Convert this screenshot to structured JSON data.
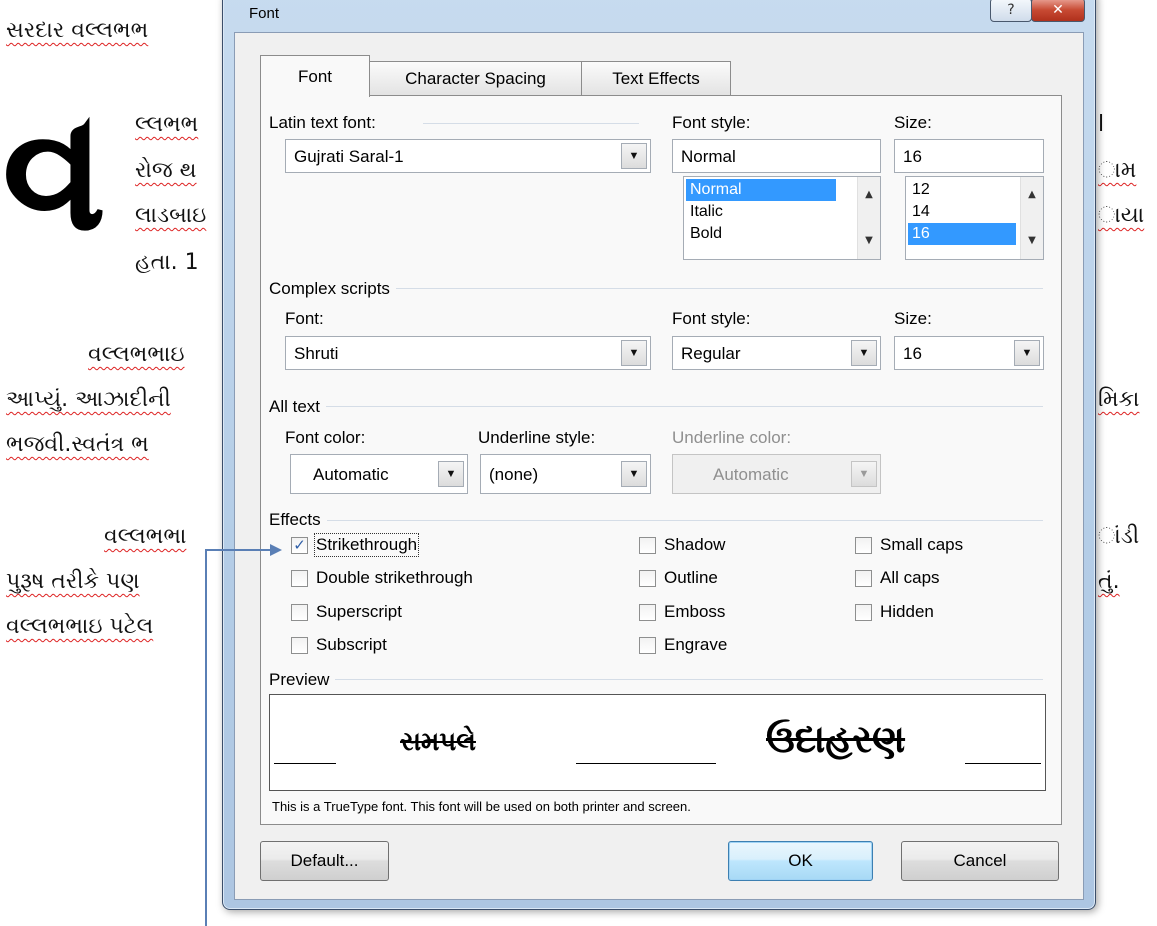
{
  "document": {
    "line1": "સરદાર વલ્લભભ",
    "dropcap": "વ",
    "para1": [
      "લ્લભભ",
      "રોજ થ",
      "લાડબાઇ",
      "હતા.  1"
    ],
    "para2_indent": "વલ્લભભાઇ",
    "para2": [
      "આપ્યું. આઝાદીની",
      "ભજવી.સ્વતંત્ર  ભ"
    ],
    "para3_indent": "વલ્લભભા",
    "para3": [
      "પુરૂષ  તરીકે પણ",
      "વલ્લભભાઇ  પટેલ"
    ],
    "right_fragments": [
      "l",
      "ામ",
      "ાયા",
      "મિકા",
      "ાંડી",
      "તું."
    ]
  },
  "dialog": {
    "title": "Font",
    "help_glyph": "?",
    "close_glyph": "✕",
    "tabs": [
      "Font",
      "Character Spacing",
      "Text Effects"
    ],
    "latin": {
      "font_label": "Latin text font:",
      "font_value": "Gujrati Saral-1",
      "style_label": "Font style:",
      "style_value": "Normal",
      "style_list": [
        "Normal",
        "Italic",
        "Bold"
      ],
      "style_selected": "Normal",
      "size_label": "Size:",
      "size_value": "16",
      "size_list": [
        "12",
        "14",
        "16"
      ],
      "size_selected": "16"
    },
    "complex": {
      "group_label": "Complex scripts",
      "font_label": "Font:",
      "font_value": "Shruti",
      "style_label": "Font style:",
      "style_value": "Regular",
      "size_label": "Size:",
      "size_value": "16"
    },
    "all_text": {
      "group_label": "All text",
      "color_label": "Font color:",
      "color_value": "Automatic",
      "underline_label": "Underline style:",
      "underline_value": "(none)",
      "ucolor_label": "Underline color:",
      "ucolor_value": "Automatic"
    },
    "effects": {
      "group_label": "Effects",
      "items": [
        {
          "label": "Strikethrough",
          "checked": true
        },
        {
          "label": "Double strikethrough",
          "checked": false
        },
        {
          "label": "Superscript",
          "checked": false
        },
        {
          "label": "Subscript",
          "checked": false
        },
        {
          "label": "Shadow",
          "checked": false
        },
        {
          "label": "Outline",
          "checked": false
        },
        {
          "label": "Emboss",
          "checked": false
        },
        {
          "label": "Engrave",
          "checked": false
        },
        {
          "label": "Small caps",
          "checked": false
        },
        {
          "label": "All caps",
          "checked": false
        },
        {
          "label": "Hidden",
          "checked": false
        }
      ]
    },
    "preview": {
      "group_label": "Preview",
      "text_small": "સમપલે",
      "text_large": "ઉદાહરણ",
      "note": "This is a TrueType font. This font will be used on both printer and screen."
    },
    "buttons": {
      "default": "Default...",
      "ok": "OK",
      "cancel": "Cancel"
    }
  },
  "colors": {
    "selection": "#3399ff",
    "close_button": "#c74a33",
    "annotation_arrow": "#5a7fb5"
  }
}
